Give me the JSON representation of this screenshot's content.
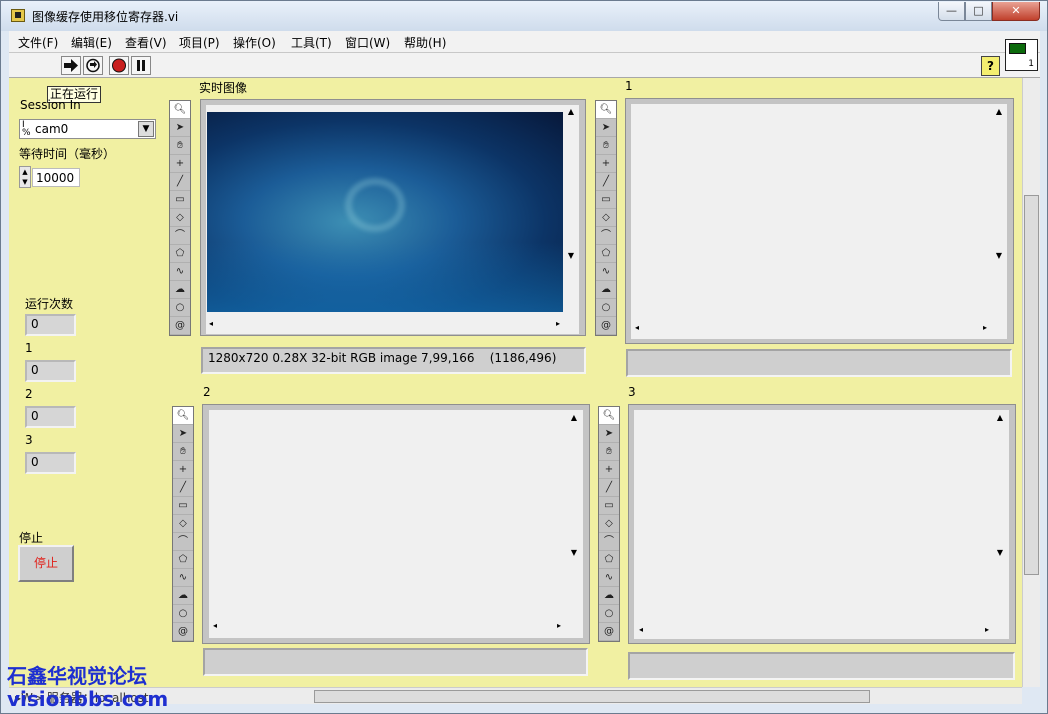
{
  "window": {
    "title": "图像缓存使用移位寄存器.vi",
    "min": "—",
    "max": "□",
    "close": "✕"
  },
  "menu": [
    "文件(F)",
    "编辑(E)",
    "查看(V)",
    "项目(P)",
    "操作(O)",
    "工具(T)",
    "窗口(W)",
    "帮助(H)"
  ],
  "toolbar": {
    "run_icon": "run-arrow-icon",
    "run_cont_icon": "run-continuously-icon",
    "abort_icon": "abort-icon",
    "pause_icon": "pause-icon",
    "help": "?"
  },
  "tooltip": "正在运行",
  "controls": {
    "session_label": "Session In",
    "session_value": "cam0",
    "timeout_label": "等待时间（毫秒）",
    "timeout_value": "10000",
    "run_count_label": "运行次数",
    "run_count_value": "0",
    "ind1_label": "1",
    "ind1_value": "0",
    "ind2_label": "2",
    "ind2_value": "0",
    "ind3_label": "3",
    "ind3_value": "0",
    "stop_label": "停止",
    "stop_button": "停止"
  },
  "displays": {
    "main_label": "实时图像",
    "main_status": "1280x720 0.28X 32-bit RGB image 7,99,166    (1186,496)",
    "d1_label": "1",
    "d2_label": "2",
    "d3_label": "3"
  },
  "vi_icon_number": "1",
  "statusline": "▸W> 服务器：localhost",
  "watermark": {
    "line1": "石鑫华视觉论坛",
    "line2": "visionbbs.com"
  },
  "icons": [
    "zoom-icon",
    "arrow-icon",
    "pan-hand-icon",
    "point-icon",
    "line-icon",
    "rectangle-icon",
    "rotated-rect-icon",
    "annulus-icon",
    "polygon-icon",
    "freehand-icon",
    "freehand-region-icon",
    "oval-icon",
    "spiral-icon"
  ]
}
